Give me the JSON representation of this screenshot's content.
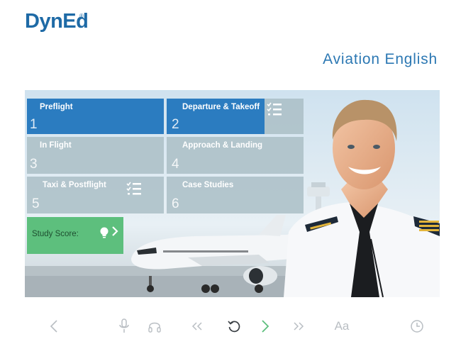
{
  "brand": {
    "logo_text": "DynEd",
    "registered_mark": "®",
    "color": "#1e6aa6"
  },
  "course": {
    "title": "Aviation English",
    "color": "#2c78b3"
  },
  "modules": [
    {
      "number": "1",
      "label": "Preflight",
      "active": true,
      "checklist": false
    },
    {
      "number": "2",
      "label": "Departure & Takeoff",
      "active": true,
      "checklist": true
    },
    {
      "number": "3",
      "label": "In Flight",
      "active": false,
      "checklist": false
    },
    {
      "number": "4",
      "label": "Approach & Landing",
      "active": false,
      "checklist": false
    },
    {
      "number": "5",
      "label": "Taxi & Postflight",
      "active": false,
      "checklist": true
    },
    {
      "number": "6",
      "label": "Case Studies",
      "active": false,
      "checklist": false
    }
  ],
  "study_score": {
    "label": "Study Score:",
    "icon": "lightbulb-icon",
    "action_icon": "chevron-right-icon",
    "color": "#5dbf7d"
  },
  "toolbar": {
    "buttons": [
      "back-icon",
      "microphone-icon",
      "headphones-icon",
      "rewind-icon",
      "replay-icon",
      "next-icon",
      "fast-forward-icon",
      "font-size-icon",
      "clock-icon"
    ],
    "font_label": "Aa",
    "accent_color": "#5dbf7d",
    "inactive_color": "#b9bec3"
  },
  "colors": {
    "tile_active": "#2b7cc0",
    "tile_inactive": "#aabec6"
  }
}
